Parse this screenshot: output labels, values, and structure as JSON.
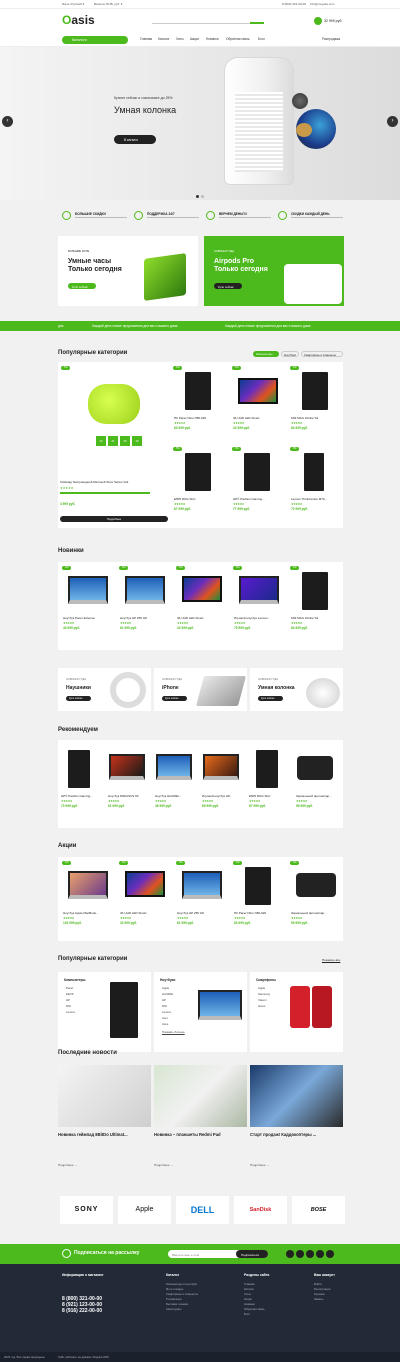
{
  "topbar": {
    "lang": "Язык: Русский ▾",
    "currency": "Валюта: RUB, руб. ▾",
    "phone": "8 (800) 321-00-00",
    "email": "info@mogutа.com"
  },
  "header": {
    "logo_o": "O",
    "logo_rest": "asis",
    "cart_total": "32 999 руб."
  },
  "nav": {
    "catalog_btn": "Каталоги",
    "items": [
      "Главная",
      "Каталог",
      "Хиты",
      "Акции",
      "Новинки",
      "Обратная связь",
      "Блог"
    ],
    "compare": "Распродажа"
  },
  "hero": {
    "subtitle": "Купите сейчас и сэкономьте до 25%",
    "title": "Умная колонка",
    "button": "В каталог"
  },
  "features": [
    {
      "title": "БОЛЬШИЕ СКИДКИ"
    },
    {
      "title": "ПОДДЕРЖКА 24/7"
    },
    {
      "title": "ВЕРНЕМ ДЕНЬГИ"
    },
    {
      "title": "СКИДКИ КАЖДЫЙ ДЕНЬ"
    }
  ],
  "promos": [
    {
      "kicker": "БОЛЬШИЕ ХИТЫ",
      "title_line1": "Умные часы",
      "title_line2": "Только сегодня",
      "button": "Купи сейчас"
    },
    {
      "kicker": "НОВИНКИ ГОДА",
      "title_line1": "Airpods Pro",
      "title_line2": "Только сегодня",
      "button": "Купи сейчас"
    }
  ],
  "ticker": [
    "дня",
    "Каждый день новые предложения для вас и вашего дома",
    "Каждый день новые предложения для вас и вашего дома"
  ],
  "popular": {
    "title": "Популярные категории",
    "tabs": [
      "Компьютеры",
      "Ноутбуки",
      "Смартфоны и планшеты"
    ],
    "featured": {
      "badge": "-5%",
      "name": "Геймпад беспроводной Microsoft Xbox Series Volt",
      "timer": [
        "12",
        "21",
        "23",
        "16"
      ],
      "price": "4 999 руб.",
      "button": "Подробнее"
    },
    "items": [
      {
        "badge": "-6%",
        "name": "ПК Pacer Nitro N50-620",
        "price": "63 999 руб."
      },
      {
        "badge": "-5%",
        "name": "4K UHD LED Smart",
        "price": "32 999 руб."
      },
      {
        "badge": "-5%",
        "name": "MSI MAG Infinite S3",
        "price": "84 999 руб."
      },
      {
        "badge": "-5%",
        "name": "E505 ROG Strix",
        "price": "67 999 руб."
      },
      {
        "badge": "-5%",
        "name": "HP® Pavilion Gaming...",
        "price": "77 999 руб."
      },
      {
        "badge": "-5%",
        "name": "Lenovo ThinkCentre M70...",
        "price": "72 999 руб."
      }
    ]
  },
  "novelties": {
    "title": "Новинки",
    "items": [
      {
        "badge": "-5%",
        "name": "Ноутбук Pacer Extensa",
        "price": "40 999 руб."
      },
      {
        "badge": "-5%",
        "name": "Ноутбук HP 255 G8",
        "price": "61 999 руб."
      },
      {
        "badge": "-5%",
        "name": "4K UHD LED Smart",
        "price": "32 999 руб."
      },
      {
        "badge": "-5%",
        "name": "Игровой ноутбук Lenovo...",
        "price": "79 999 руб."
      },
      {
        "badge": "-5%",
        "name": "MSI MAG Infinite S3",
        "price": "84 999 руб."
      }
    ]
  },
  "mini_banners": [
    {
      "kicker": "НОВИНКИ ГОДА",
      "title": "Наушники",
      "button": "Купи сейчас"
    },
    {
      "kicker": "НОВИНКИ ГОДА",
      "title": "iPhone",
      "button": "Купи сейчас"
    },
    {
      "kicker": "НОВИНКИ ГОДА",
      "title": "Умная колонка",
      "button": "Купи сейчас"
    }
  ],
  "recommend": {
    "title": "Рекомендуем",
    "items": [
      {
        "name": "HP® Pavilion Gaming...",
        "price": "73 999 руб."
      },
      {
        "name": "Ноутбук MSI/ASUS 60",
        "price": "61 999 руб."
      },
      {
        "name": "Ноутбук HUAWEI...",
        "price": "46 999 руб."
      },
      {
        "name": "Игровой ноутбук HP...",
        "price": "69 999 руб."
      },
      {
        "name": "E505 ROG Strix",
        "price": "67 999 руб."
      },
      {
        "name": "Зеркальный фотоаппар...",
        "price": "59 999 руб."
      }
    ]
  },
  "sale": {
    "title": "Акции",
    "items": [
      {
        "badge": "-5%",
        "name": "Ноутбук Apple MacBook...",
        "price": "129 999 руб."
      },
      {
        "badge": "-5%",
        "name": "4K UHD LED Smart",
        "price": "32 999 руб."
      },
      {
        "badge": "-5%",
        "name": "Ноутбук HP 255 G8",
        "price": "61 999 руб."
      },
      {
        "badge": "-5%",
        "name": "ПК Pacer Nitro N50-620",
        "price": "63 999 руб."
      },
      {
        "badge": "-5%",
        "name": "Зеркальный фотоаппар...",
        "price": "59 999 руб."
      }
    ]
  },
  "popcats": {
    "title": "Популярные категории",
    "all_link": "Показать все",
    "cols": [
      {
        "title": "Компьютеры",
        "items": [
          "Pacer",
          "DEXP",
          "HP",
          "MSI",
          "Lenovo"
        ]
      },
      {
        "title": "Ноутбуки",
        "items": [
          "Apple",
          "HUAWEI",
          "HP",
          "MSI",
          "Lenovo",
          "Acer",
          "Asus"
        ],
        "more": "Показать больше"
      },
      {
        "title": "Смартфоны",
        "items": [
          "Apple",
          "Samsung",
          "Xiaomi",
          "Honor"
        ]
      }
    ]
  },
  "news": {
    "title": "Последние новости",
    "items": [
      {
        "title": "Новинка геймпад 8BitDo Ultimat...",
        "more": "Подробнее →"
      },
      {
        "title": "Новинка – планшеты Redmi Pad",
        "more": "Подробнее →"
      },
      {
        "title": "Старт продаж! Каддокоптеры ...",
        "more": "Подробнее →"
      }
    ]
  },
  "brands": [
    "SONY",
    "Apple",
    "DELL",
    "SanDisk",
    "BOSE"
  ],
  "subscribe": {
    "title": "Подписаться на рассылку",
    "placeholder": "Введите ваш e-mail",
    "button": "Подписаться"
  },
  "footer": {
    "info_title": "Информация о магазине",
    "phones": [
      "8 (800) 321-00-00",
      "8 (921) 123-00-00",
      "8 (916) 222-00-00"
    ],
    "catalog_title": "Каталог",
    "catalog_items": [
      "Компьютеры и ноутбуки",
      "Фото и видео",
      "Смартфоны и планшеты",
      "Телевизоры",
      "Бытовая техника",
      "Аксессуары"
    ],
    "sections_title": "Разделы сайта",
    "sections_items": [
      "Главная",
      "Каталог",
      "Хиты",
      "Акции",
      "Новинки",
      "Обратная связь",
      "Блог"
    ],
    "account_title": "Ваш аккаунт",
    "account_items": [
      "Войти",
      "Регистрация",
      "Корзина",
      "Заказы"
    ],
    "copyright": "2023 год. Все права защищены",
    "powered": "Сайт работает на движке: Moguta.CMS"
  },
  "colors": {
    "accent": "#4cb91c",
    "dark": "#222a38"
  }
}
